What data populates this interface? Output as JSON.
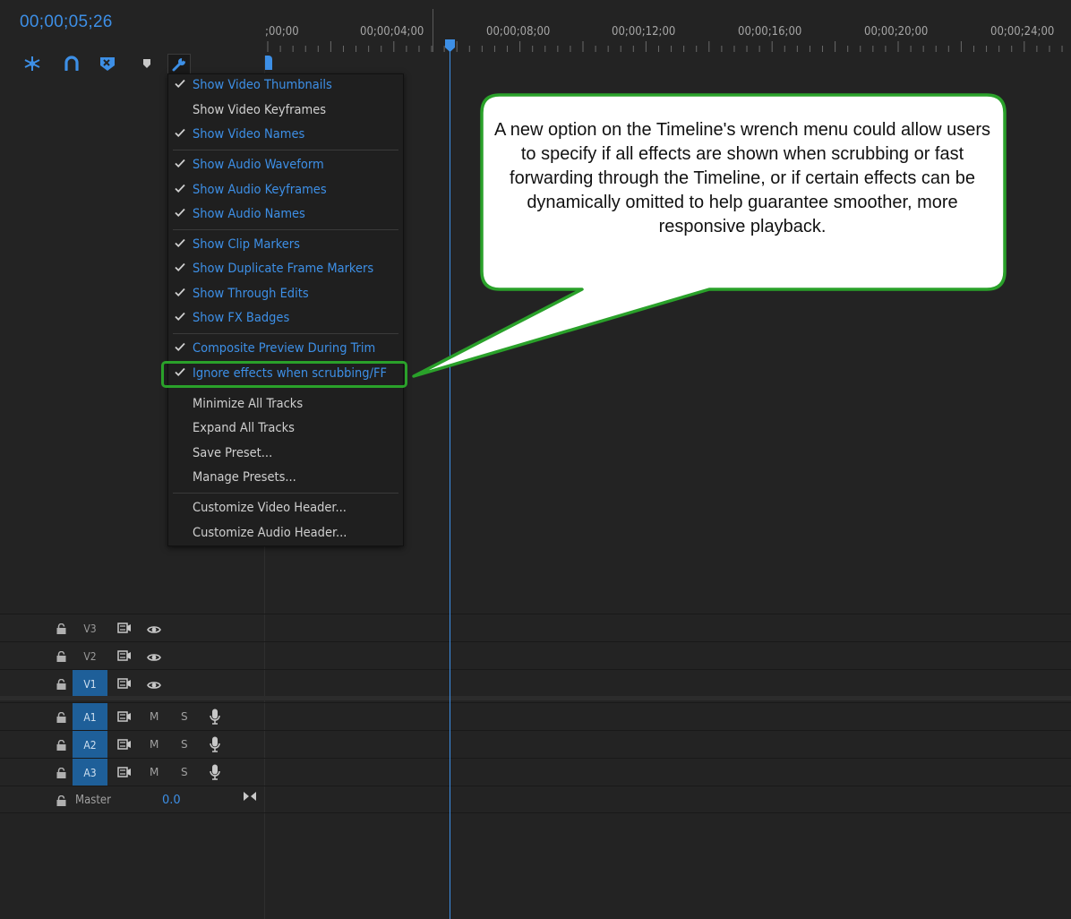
{
  "timecode": "00;00;05;26",
  "ruler": {
    "labels": [
      ";00;00",
      "00;00;04;00",
      "00;00;08;00",
      "00;00;12;00",
      "00;00;16;00",
      "00;00;20;00",
      "00;00;24;00"
    ]
  },
  "toolbar": {
    "icons": [
      "snap-icon",
      "linked-selection-icon",
      "add-marker-icon",
      "marker-icon",
      "wrench-icon"
    ]
  },
  "menu": {
    "groups": [
      [
        {
          "label": "Show Video Thumbnails",
          "checked": true
        },
        {
          "label": "Show Video Keyframes",
          "checked": false
        },
        {
          "label": "Show Video Names",
          "checked": true
        }
      ],
      [
        {
          "label": "Show Audio Waveform",
          "checked": true
        },
        {
          "label": "Show Audio Keyframes",
          "checked": true
        },
        {
          "label": "Show Audio Names",
          "checked": true
        }
      ],
      [
        {
          "label": "Show Clip Markers",
          "checked": true
        },
        {
          "label": "Show Duplicate Frame Markers",
          "checked": true
        },
        {
          "label": "Show Through Edits",
          "checked": true
        },
        {
          "label": "Show FX Badges",
          "checked": true
        }
      ],
      [
        {
          "label": "Composite Preview During Trim",
          "checked": true
        },
        {
          "label": "Ignore effects when scrubbing/FF",
          "checked": true,
          "highlighted": true
        },
        {
          "label": "Minimize All Tracks",
          "checked": false
        },
        {
          "label": "Expand All Tracks",
          "checked": false
        },
        {
          "label": "Save Preset...",
          "checked": false
        },
        {
          "label": "Manage Presets...",
          "checked": false
        }
      ],
      [
        {
          "label": "Customize Video Header...",
          "checked": false
        },
        {
          "label": "Customize Audio Header...",
          "checked": false
        }
      ]
    ]
  },
  "callout": {
    "text": "A new option on the Timeline's wrench menu could allow users to specify if all effects are shown when scrubbing or fast forwarding through the Timeline, or if certain effects can be dynamically omitted to help guarantee smoother, more responsive playback."
  },
  "tracks": {
    "video": [
      {
        "name": "V3",
        "selected": false
      },
      {
        "name": "V2",
        "selected": false
      },
      {
        "name": "V1",
        "selected": true
      }
    ],
    "audio": [
      {
        "name": "A1",
        "selected": true,
        "mute": "M",
        "solo": "S"
      },
      {
        "name": "A2",
        "selected": true,
        "mute": "M",
        "solo": "S"
      },
      {
        "name": "A3",
        "selected": true,
        "mute": "M",
        "solo": "S"
      }
    ],
    "master": {
      "label": "Master",
      "value": "0.0"
    }
  },
  "colors": {
    "accent": "#3d8fe6",
    "background": "#232323",
    "highlight_border": "#2aa12a",
    "selected_track": "#1e5f99"
  }
}
